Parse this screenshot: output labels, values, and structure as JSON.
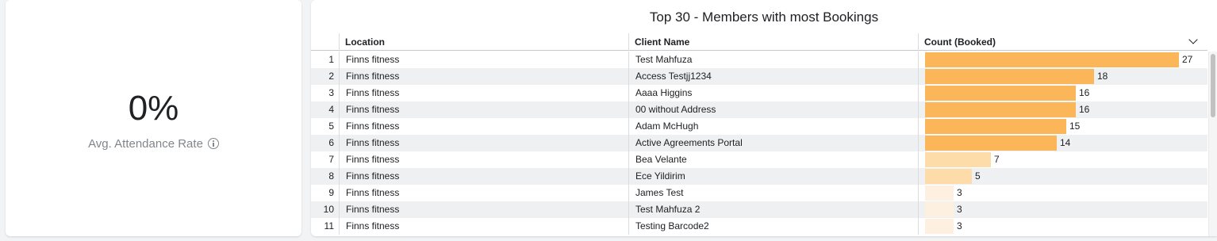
{
  "kpi": {
    "value": "0%",
    "label": "Avg. Attendance Rate"
  },
  "table": {
    "title": "Top 30 - Members with most Bookings",
    "columns": [
      "Location",
      "Client Name",
      "Count (Booked)"
    ],
    "rows": [
      {
        "index": "1",
        "location": "Finns fitness",
        "client": "Test Mahfuza",
        "count": 27
      },
      {
        "index": "2",
        "location": "Finns fitness",
        "client": "Access Testjj1234",
        "count": 18
      },
      {
        "index": "3",
        "location": "Finns fitness",
        "client": "Aaaa Higgins",
        "count": 16
      },
      {
        "index": "4",
        "location": "Finns fitness",
        "client": "00 without Address",
        "count": 16
      },
      {
        "index": "5",
        "location": "Finns fitness",
        "client": "Adam McHugh",
        "count": 15
      },
      {
        "index": "6",
        "location": "Finns fitness",
        "client": "Active Agreements Portal",
        "count": 14
      },
      {
        "index": "7",
        "location": "Finns fitness",
        "client": "Bea Velante",
        "count": 7
      },
      {
        "index": "8",
        "location": "Finns fitness",
        "client": "Ece Yildirim",
        "count": 5
      },
      {
        "index": "9",
        "location": "Finns fitness",
        "client": "James Test",
        "count": 3
      },
      {
        "index": "10",
        "location": "Finns fitness",
        "client": "Test Mahfuza 2",
        "count": 3
      },
      {
        "index": "11",
        "location": "Finns fitness",
        "client": "Testing Barcode2",
        "count": 3
      }
    ],
    "colors": {
      "bar_high": "#fbb65a",
      "bar_mid": "#fddcaa",
      "bar_low": "#fdf0e0"
    },
    "icons": {
      "sort": "chevron-down-icon",
      "info": "info-icon"
    }
  }
}
